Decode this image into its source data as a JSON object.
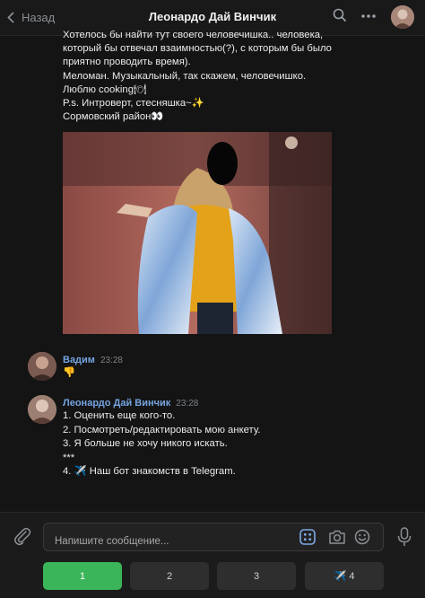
{
  "header": {
    "back_label": "Назад",
    "title": "Леонардо Дай Винчик"
  },
  "profile_message": {
    "lines": [
      "Хотелось бы найти тут своего человечишка.. человека,",
      "который бы отвечал взаимностью(?), с которым бы было",
      "приятно проводить время).",
      "Меломан. Музыкальный, так скажем, человечишко.",
      "Люблю cooking🍽",
      "P.s. Интроверт, стесняшка~✨",
      "Сормовский район👀"
    ]
  },
  "messages": [
    {
      "author": "Вадим",
      "time": "23:28",
      "lines": [
        "👎"
      ]
    },
    {
      "author": "Леонардо Дай Винчик",
      "time": "23:28",
      "lines": [
        "1. Оценить еще кого-то.",
        "2. Посмотреть/редактировать мою анкету.",
        "3. Я больше не хочу никого искать.",
        "***",
        "4. ✈️ Наш бот знакомств в Telegram."
      ]
    }
  ],
  "composer": {
    "placeholder": "Напишите сообщение..."
  },
  "keyboard": {
    "buttons": [
      "1",
      "2",
      "3",
      "✈️ 4"
    ],
    "primary_color": "#3bb559"
  }
}
